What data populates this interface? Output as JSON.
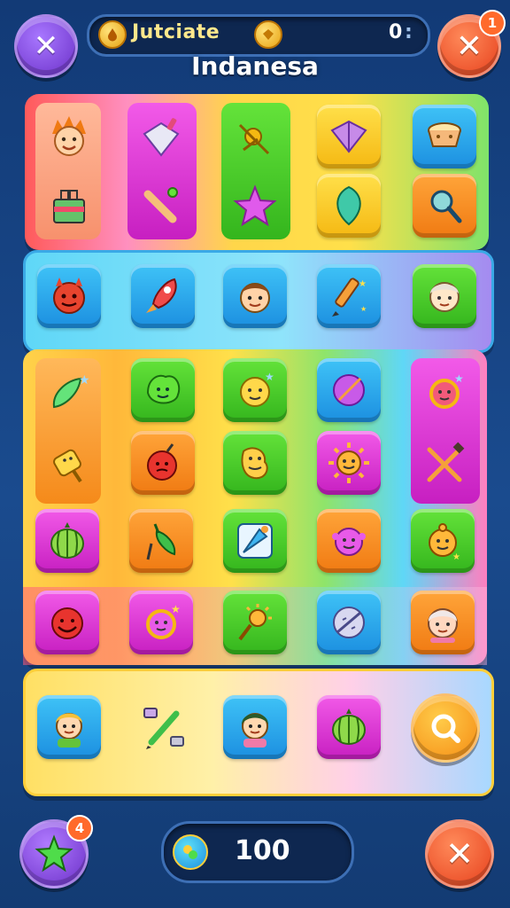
{
  "header": {
    "coins_label": "Jutciate",
    "coins_value": "0",
    "coins_value_suffix": ":",
    "title": "Indanesa",
    "close_badge": "1"
  },
  "footer": {
    "star_badge": "4",
    "score": "100"
  },
  "icons": {
    "left_close": "close-icon",
    "right_close": "close-icon",
    "star": "star-icon",
    "search": "search-icon"
  },
  "colors": {
    "background": "#1a4b8e",
    "green_tile": "#34b51d",
    "magenta_tile": "#c71fc1",
    "orange_tile": "#f07a12",
    "blue_tile": "#1c8fe0",
    "yellow_tile": "#f5b812",
    "close_red": "#f04b23",
    "close_purple": "#8a3fd1"
  }
}
